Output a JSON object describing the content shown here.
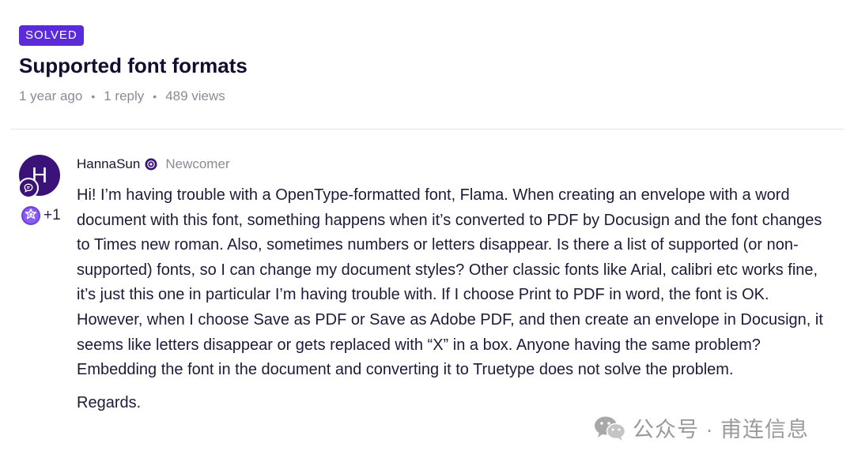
{
  "topic": {
    "badge": "SOLVED",
    "title": "Supported font formats",
    "meta": {
      "age": "1 year ago",
      "replies": "1 reply",
      "views": "489 views",
      "separator": "•"
    }
  },
  "post": {
    "avatar_letter": "H",
    "kudos": "+1",
    "author": "HannaSun",
    "rank": "Newcomer",
    "body": "Hi! I’m having trouble with a OpenType-formatted font, Flama. When creating an envelope with a word document with this font, something happens when it’s converted to PDF by Docusign and the font changes to Times new roman. Also, sometimes numbers or letters disappear. Is there a list of supported (or non-supported) fonts, so I can change my document styles? Other classic fonts like Arial, calibri etc works fine, it’s just this one in particular I’m having trouble with. If I choose Print to PDF in word, the font is OK. However, when I choose Save as PDF or Save as Adobe PDF, and then create an envelope in Docusign, it seems like letters disappear or gets replaced with “X” in a box. Anyone having the same problem? Embedding the font in the document and converting it to Truetype does not solve the problem.",
    "closing": "Regards."
  },
  "watermark": {
    "text": "公众号 · 甫连信息"
  },
  "colors": {
    "accent": "#5b2bd9",
    "avatar": "#3a1278",
    "muted_text": "#8c8a96"
  },
  "icons": {
    "avatar_badge": "chat-bubble-icon",
    "kudos": "kudos-gear-icon",
    "rank": "rank-icon",
    "watermark": "wechat-logo-icon"
  }
}
